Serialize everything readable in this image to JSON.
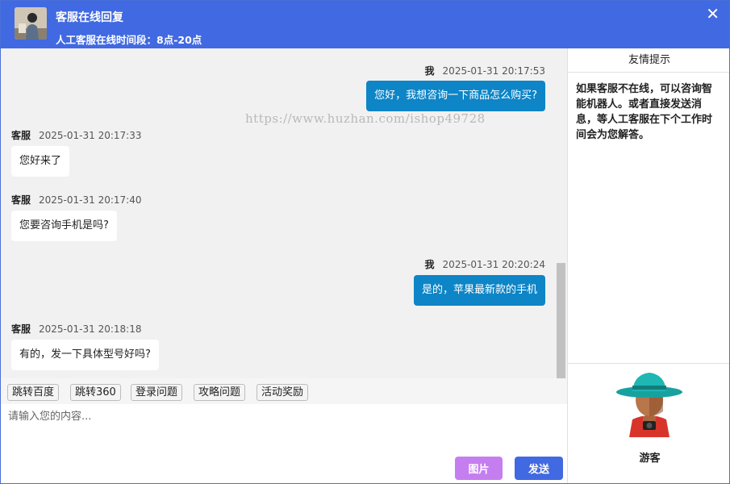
{
  "header": {
    "title": "客服在线回复",
    "subtitle": "人工客服在线时间段：8点-20点",
    "close_icon": "close-icon",
    "background": "#4169e1"
  },
  "watermark": "https://www.huzhan.com/ishop49728",
  "messages": [
    {
      "sender": "我",
      "time": "2025-01-31 20:17:53",
      "text": "您好，我想咨询一下商品怎么购买?",
      "side": "right"
    },
    {
      "sender": "客服",
      "time": "2025-01-31 20:17:33",
      "text": "您好来了",
      "side": "left"
    },
    {
      "sender": "客服",
      "time": "2025-01-31 20:17:40",
      "text": "您要咨询手机是吗?",
      "side": "left"
    },
    {
      "sender": "我",
      "time": "2025-01-31 20:20:24",
      "text": "是的，苹果最新款的手机",
      "side": "right"
    },
    {
      "sender": "客服",
      "time": "2025-01-31 20:18:18",
      "text": "有的，发一下具体型号好吗?",
      "side": "left"
    }
  ],
  "quick_replies": [
    "跳转百度",
    "跳转360",
    "登录问题",
    "攻略问题",
    "活动奖励"
  ],
  "input": {
    "placeholder": "请输入您的内容...",
    "value": ""
  },
  "buttons": {
    "image": "图片",
    "send": "发送"
  },
  "colors": {
    "my_bubble": "#0d85c7",
    "image_button": "#c57ef0",
    "send_button": "#4169e1"
  },
  "side": {
    "title": "友情提示",
    "tip": "如果客服不在线，可以咨询智能机器人。或者直接发送消息，等人工客服在下个工作时间会为您解答。",
    "visitor_name": "游客"
  }
}
